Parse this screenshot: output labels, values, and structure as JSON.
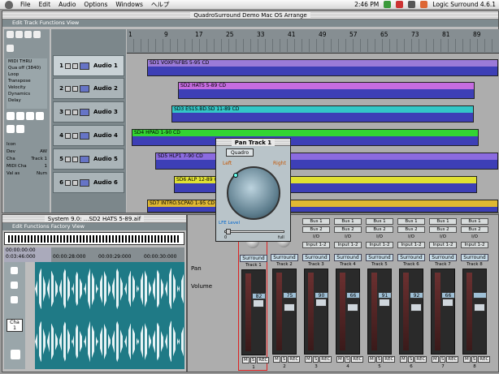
{
  "menubar": {
    "items": [
      "File",
      "Edit",
      "Audio",
      "Options",
      "Windows",
      "ヘルプ"
    ],
    "clock": "2:46 PM",
    "app_name": "Logic Surround 4.6.1"
  },
  "arrange": {
    "title": "QuadroSurround Demo Mac OS Arrange",
    "menu": "Edit  Track  Functions  View",
    "bars": [
      "1",
      "9",
      "17",
      "25",
      "33",
      "41",
      "49",
      "57",
      "65",
      "73",
      "81",
      "89"
    ],
    "toolbox": {
      "lines": [
        "MIDI THRU",
        "Qua  off (3840)",
        "Loop",
        "Transpose",
        "Velocity",
        "Dynamics",
        "Delay"
      ],
      "params": [
        [
          "Icon",
          ""
        ],
        [
          "Dev",
          "AW"
        ],
        [
          "Cha",
          "Track 1"
        ],
        [
          "MIDI Cha",
          "1"
        ],
        [
          "Val as",
          "Num"
        ]
      ]
    },
    "tracks": [
      {
        "num": "1",
        "name": "Audio 1"
      },
      {
        "num": "2",
        "name": "Audio 2"
      },
      {
        "num": "3",
        "name": "Audio 3"
      },
      {
        "num": "4",
        "name": "Audio 4"
      },
      {
        "num": "5",
        "name": "Audio 5"
      },
      {
        "num": "6",
        "name": "Audio 6"
      }
    ],
    "regions": [
      {
        "label": "SD1 VOXF%FBS 5-95 CD",
        "color": "#9b7bd8"
      },
      {
        "label": "SD2 HATS 5-89 CD",
        "color": "#c56ce0"
      },
      {
        "label": "SD3 ES1S.BD.SD 11-89 CD",
        "color": "#33c7c7"
      },
      {
        "label": "SD4 HPAD 1-90 CD",
        "color": "#33d433"
      },
      {
        "label": "SD5 HLP1 7-90 CD",
        "color": "#8b6be0"
      },
      {
        "label": "SD6 ALP 12-89 CD",
        "color": "#e0e033"
      },
      {
        "label": "SD7 INTRO.SCPA0 1-95 CD",
        "color": "#e0b833"
      }
    ]
  },
  "sample_editor": {
    "title": "System 9.0: ...SD2 HATS 5-89.aif",
    "menu": "Edit  Functions  Factory  View",
    "time1": "00:00:00:00",
    "time2": "0:03:46:000",
    "ticks": [
      "00:00:28:000",
      "00:00:29:000",
      "00:00:30:000"
    ],
    "cha_label": "Cha",
    "cha_value": "1"
  },
  "pan_window": {
    "title": "Pan Track 1",
    "mode": "Quadro",
    "left": "Left",
    "right": "Right",
    "lfe_label": "LFE Level",
    "lfe_min": "0",
    "lfe_max": "full"
  },
  "mixer": {
    "pan_label": "Pan",
    "volume_label": "Volume",
    "strips": [
      {
        "bus1": "",
        "bus2": "",
        "io": "",
        "input": "",
        "mode": "Surround",
        "track": "Track 1",
        "value": "82",
        "num": "1",
        "selected": true
      },
      {
        "bus1": "",
        "bus2": "",
        "io": "",
        "input": "",
        "mode": "Surround",
        "track": "Track 2",
        "value": "75",
        "num": "2"
      },
      {
        "bus1": "Bus 1",
        "bus2": "Bus 2",
        "io": "I/O",
        "input": "Input 1-2",
        "mode": "Surround",
        "track": "Track 3",
        "value": "90",
        "num": "3"
      },
      {
        "bus1": "Bus 1",
        "bus2": "Bus 2",
        "io": "I/O",
        "input": "Input 1-2",
        "mode": "Surround",
        "track": "Track 4",
        "value": "66",
        "num": "4"
      },
      {
        "bus1": "Bus 1",
        "bus2": "Bus 2",
        "io": "I/O",
        "input": "Input 1-2",
        "mode": "Surround",
        "track": "Track 5",
        "value": "91",
        "num": "5"
      },
      {
        "bus1": "Bus 1",
        "bus2": "Bus 2",
        "io": "I/O",
        "input": "Input 1-2",
        "mode": "Surround",
        "track": "Track 6",
        "value": "92",
        "num": "6"
      },
      {
        "bus1": "Bus 1",
        "bus2": "Bus 2",
        "io": "I/O",
        "input": "Input 1-2",
        "mode": "Surround",
        "track": "Track 7",
        "value": "66",
        "num": "7"
      },
      {
        "bus1": "Bus 1",
        "bus2": "Bus 2",
        "io": "I/O",
        "input": "Input 1-2",
        "mode": "Surround",
        "track": "Track 8",
        "value": "",
        "num": "8"
      }
    ],
    "mute": "M",
    "solo": "S",
    "rec": "REC"
  }
}
